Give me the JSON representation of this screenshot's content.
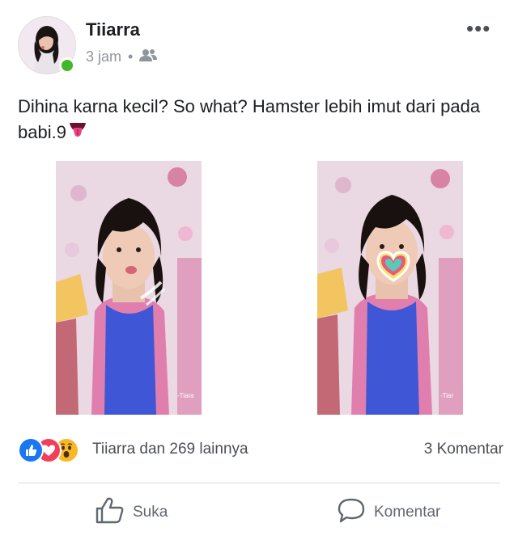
{
  "post": {
    "author": "Tiiarra",
    "time": "3 jam",
    "separator": "•",
    "audience_icon": "friends-icon",
    "more_icon": "more-icon",
    "more_label": "•••",
    "text_line1": "Dihina karna kecil? So what? Hamster lebih imut dari pada",
    "text_line2": "babi.9",
    "emoji": "tongue-emoji",
    "watermark_1": "-Tiara",
    "watermark_2": "-Tiar"
  },
  "reactions": {
    "icons": [
      "like-reaction-icon",
      "love-reaction-icon",
      "wow-reaction-icon"
    ],
    "names": "Tiiarra dan 269 lainnya",
    "comments": "3 Komentar"
  },
  "actions": {
    "like_label": "Suka",
    "comment_label": "Komentar"
  },
  "colors": {
    "like_blue": "#1877f2",
    "love_red": "#f33e58",
    "wow_yellow": "#f7b928",
    "online_green": "#42b72a",
    "muted_text": "#90949c"
  }
}
